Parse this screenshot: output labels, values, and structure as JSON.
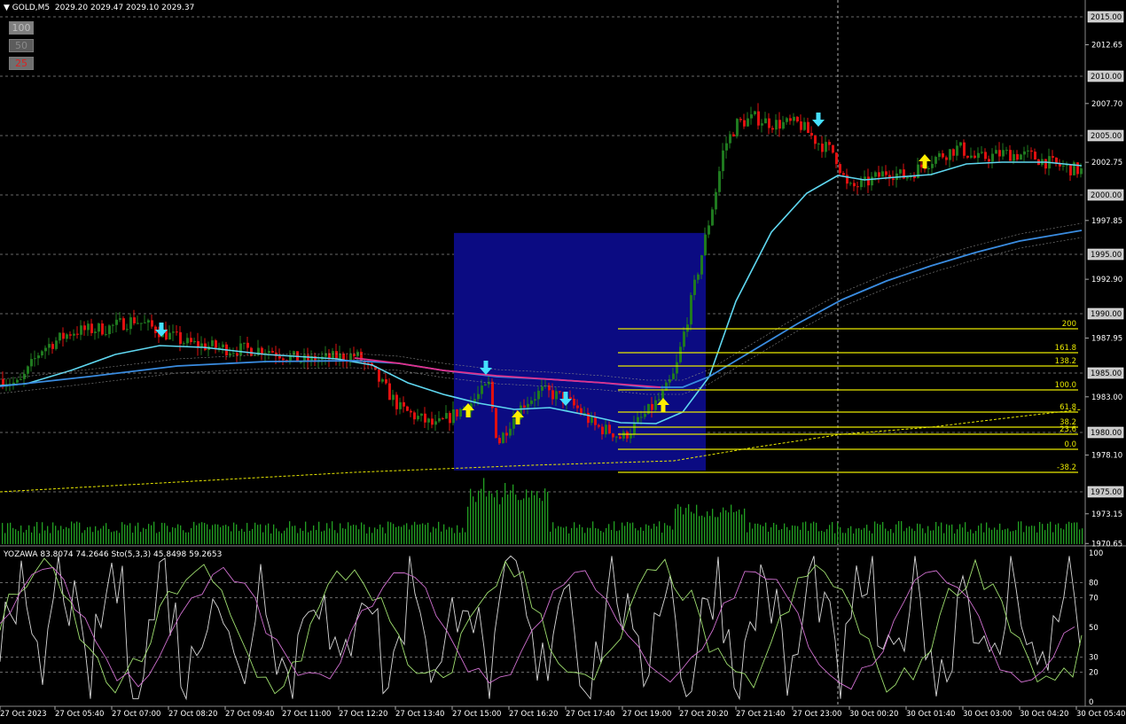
{
  "header": {
    "symbol": "GOLD,M5",
    "ohlc": "2029.20 2029.47 2029.10 2029.37"
  },
  "buttons": [
    "100",
    "50",
    "25"
  ],
  "indicator_header": "YOZAWA 83.8074 74.2646   Sto(5,3,3) 45.8498 59.2653",
  "price_ticks": [
    "2012.65",
    "2007.70",
    "2002.75",
    "1997.85",
    "1992.90",
    "1987.95",
    "1983.00",
    "1978.10",
    "1973.15",
    "1970.65"
  ],
  "price_boxes": [
    {
      "label": "2015.00",
      "price": 2015.0
    },
    {
      "label": "2010.00",
      "price": 2010.0
    },
    {
      "label": "2005.00",
      "price": 2005.0
    },
    {
      "label": "2000.00",
      "price": 2000.0
    },
    {
      "label": "1995.00",
      "price": 1995.0
    },
    {
      "label": "1990.00",
      "price": 1990.0
    },
    {
      "label": "1985.00",
      "price": 1985.0
    },
    {
      "label": "1980.00",
      "price": 1980.0
    },
    {
      "label": "1975.00",
      "price": 1975.0
    }
  ],
  "fib_labels": [
    "200",
    "161.8",
    "138.2",
    "100.0",
    "61.8",
    "38.2",
    "23.6",
    "0.0",
    "-38.2"
  ],
  "osc_ticks": [
    "100",
    "80",
    "70",
    "50",
    "30",
    "20",
    "0"
  ],
  "time_labels": [
    "27 Oct 2023",
    "27 Oct 05:40",
    "27 Oct 07:00",
    "27 Oct 08:20",
    "27 Oct 09:40",
    "27 Oct 11:00",
    "27 Oct 12:20",
    "27 Oct 13:40",
    "27 Oct 15:00",
    "27 Oct 16:20",
    "27 Oct 17:40",
    "27 Oct 19:00",
    "27 Oct 20:20",
    "27 Oct 21:40",
    "27 Oct 23:00",
    "30 Oct 00:20",
    "30 Oct 01:40",
    "30 Oct 03:00",
    "30 Oct 04:20",
    "30 Oct 05:40"
  ],
  "colors": {
    "background": "#000000",
    "bull": "#1f7a1f",
    "bear": "#e01010",
    "ma_fast": "#5fd7f0",
    "ma_slow": "#3a8ce0",
    "ma_mid": "#e0308c",
    "fib": "#e8e800",
    "box": "#0b0b82",
    "grid": "#8a8a8a",
    "volume": "#22a022"
  },
  "icons": [
    "arrow-up-icon",
    "arrow-down-icon"
  ]
}
